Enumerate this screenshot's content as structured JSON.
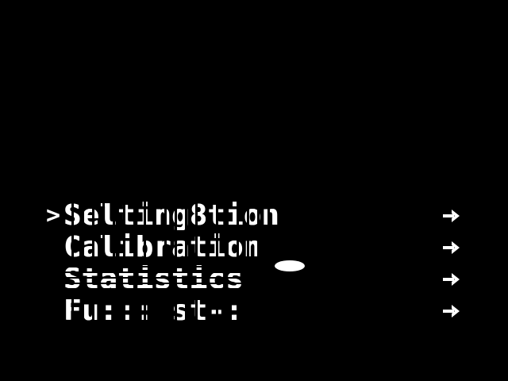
{
  "menu": {
    "cursor": ">",
    "items": [
      {
        "label": "Selting8tion",
        "selected": true,
        "arrow_icon": "right-arrow-icon"
      },
      {
        "label": "Calibration",
        "selected": false,
        "arrow_icon": "right-arrow-icon"
      },
      {
        "label": "Statistics",
        "selected": false,
        "arrow_icon": "right-arrow-icon"
      },
      {
        "label": "Fu::: st-:",
        "selected": false,
        "arrow_icon": "right-arrow-icon"
      }
    ]
  },
  "colors": {
    "background": "#000000",
    "foreground": "#ffffff"
  }
}
